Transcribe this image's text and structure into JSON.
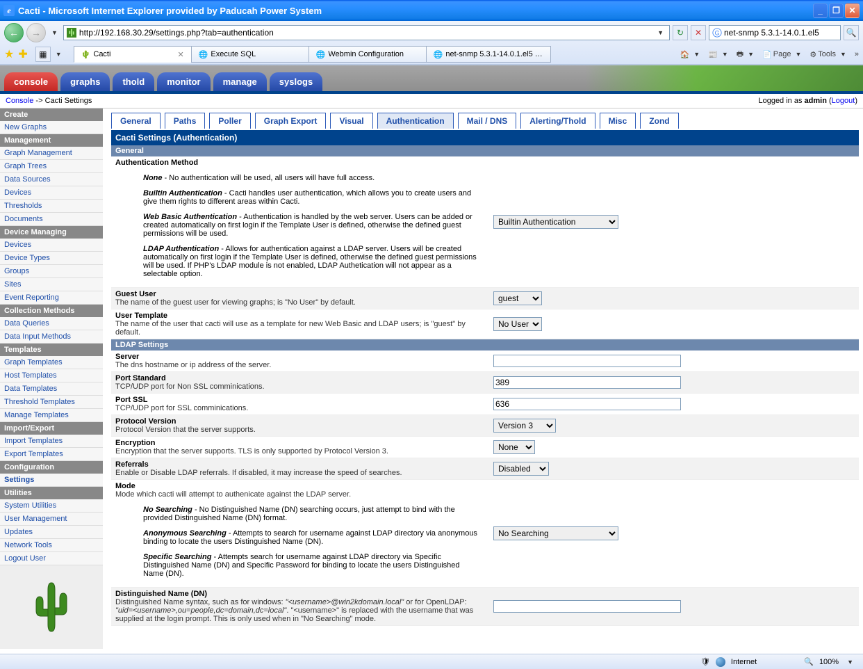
{
  "window": {
    "title": "Cacti - Microsoft Internet Explorer provided by Paducah Power System"
  },
  "address_bar": {
    "url": "http://192.168.30.29/settings.php?tab=authentication"
  },
  "search_box": {
    "value": "net-snmp 5.3.1-14.0.1.el5"
  },
  "browser_tabs": [
    {
      "label": "Cacti",
      "active": true
    },
    {
      "label": "Execute SQL",
      "active": false
    },
    {
      "label": "Webmin Configuration",
      "active": false
    },
    {
      "label": "net-snmp 5.3.1-14.0.1.el5 - …",
      "active": false
    }
  ],
  "ie_tools": {
    "page": "Page",
    "tools": "Tools"
  },
  "cacti_nav_tabs": [
    {
      "label": "console",
      "style": "red"
    },
    {
      "label": "graphs",
      "style": "blue"
    },
    {
      "label": "thold",
      "style": "blue"
    },
    {
      "label": "monitor",
      "style": "blue"
    },
    {
      "label": "manage",
      "style": "blue"
    },
    {
      "label": "syslogs",
      "style": "blue"
    }
  ],
  "breadcrumb": {
    "root": "Console",
    "sep": " -> ",
    "current": "Cacti Settings",
    "logged_in_prefix": "Logged in as ",
    "user": "admin",
    "logout_open": " (",
    "logout": "Logout",
    "logout_close": ")"
  },
  "sidebar": [
    {
      "type": "header",
      "text": "Create"
    },
    {
      "type": "link",
      "text": "New Graphs"
    },
    {
      "type": "header",
      "text": "Management"
    },
    {
      "type": "link",
      "text": "Graph Management"
    },
    {
      "type": "link",
      "text": "Graph Trees"
    },
    {
      "type": "link",
      "text": "Data Sources"
    },
    {
      "type": "link",
      "text": "Devices"
    },
    {
      "type": "link",
      "text": "Thresholds"
    },
    {
      "type": "link",
      "text": "Documents"
    },
    {
      "type": "header",
      "text": "Device Managing"
    },
    {
      "type": "link",
      "text": "Devices"
    },
    {
      "type": "link",
      "text": "Device Types"
    },
    {
      "type": "link",
      "text": "Groups"
    },
    {
      "type": "link",
      "text": "Sites"
    },
    {
      "type": "link",
      "text": "Event Reporting"
    },
    {
      "type": "header",
      "text": "Collection Methods"
    },
    {
      "type": "link",
      "text": "Data Queries"
    },
    {
      "type": "link",
      "text": "Data Input Methods"
    },
    {
      "type": "header",
      "text": "Templates"
    },
    {
      "type": "link",
      "text": "Graph Templates"
    },
    {
      "type": "link",
      "text": "Host Templates"
    },
    {
      "type": "link",
      "text": "Data Templates"
    },
    {
      "type": "link",
      "text": "Threshold Templates"
    },
    {
      "type": "link",
      "text": "Manage Templates"
    },
    {
      "type": "header",
      "text": "Import/Export"
    },
    {
      "type": "link",
      "text": "Import Templates"
    },
    {
      "type": "link",
      "text": "Export Templates"
    },
    {
      "type": "header",
      "text": "Configuration"
    },
    {
      "type": "link",
      "text": "Settings",
      "bold": true
    },
    {
      "type": "header",
      "text": "Utilities"
    },
    {
      "type": "link",
      "text": "System Utilities"
    },
    {
      "type": "link",
      "text": "User Management"
    },
    {
      "type": "link",
      "text": "Updates"
    },
    {
      "type": "link",
      "text": "Network Tools"
    },
    {
      "type": "link",
      "text": "Logout User"
    }
  ],
  "settings_tabs": [
    {
      "label": "General"
    },
    {
      "label": "Paths"
    },
    {
      "label": "Poller"
    },
    {
      "label": "Graph Export"
    },
    {
      "label": "Visual"
    },
    {
      "label": "Authentication",
      "active": true
    },
    {
      "label": "Mail / DNS"
    },
    {
      "label": "Alerting/Thold"
    },
    {
      "label": "Misc"
    },
    {
      "label": "Zond"
    }
  ],
  "settings_title": "Cacti Settings (Authentication)",
  "sections": {
    "general": "General",
    "ldap": "LDAP Settings"
  },
  "auth_method": {
    "label": "Authentication Method",
    "none_t": "None",
    "none_d": " - No authentication will be used, all users will have full access.",
    "builtin_t": "Builtin Authentication",
    "builtin_d": " - Cacti handles user authentication, which allows you to create users and give them rights to different areas within Cacti.",
    "web_t": "Web Basic Authentication",
    "web_d": " - Authentication is handled by the web server. Users can be added or created automatically on first login if the Template User is defined, otherwise the defined guest permissions will be used.",
    "ldap_t": "LDAP Authentication",
    "ldap_d": " - Allows for authentication against a LDAP server. Users will be created automatically on first login if the Template User is defined, otherwise the defined guest permissions will be used. If PHP's LDAP module is not enabled, LDAP Authetication will not appear as a selectable option.",
    "value": "Builtin Authentication"
  },
  "guest_user": {
    "label": "Guest User",
    "help": "The name of the guest user for viewing graphs; is \"No User\" by default.",
    "value": "guest"
  },
  "user_template": {
    "label": "User Template",
    "help": "The name of the user that cacti will use as a template for new Web Basic and LDAP users; is \"guest\" by default.",
    "value": "No User"
  },
  "server": {
    "label": "Server",
    "help": "The dns hostname or ip address of the server.",
    "value": ""
  },
  "port_std": {
    "label": "Port Standard",
    "help": "TCP/UDP port for Non SSL comminications.",
    "value": "389"
  },
  "port_ssl": {
    "label": "Port SSL",
    "help": "TCP/UDP port for SSL comminications.",
    "value": "636"
  },
  "proto_ver": {
    "label": "Protocol Version",
    "help": "Protocol Version that the server supports.",
    "value": "Version 3"
  },
  "encryption": {
    "label": "Encryption",
    "help": "Encryption that the server supports. TLS is only supported by Protocol Version 3.",
    "value": "None"
  },
  "referrals": {
    "label": "Referrals",
    "help": "Enable or Disable LDAP referrals. If disabled, it may increase the speed of searches.",
    "value": "Disabled"
  },
  "mode": {
    "label": "Mode",
    "help": "Mode which cacti will attempt to authenicate against the LDAP server.",
    "ns_t": "No Searching",
    "ns_d": " - No Distinguished Name (DN) searching occurs, just attempt to bind with the provided Distinguished Name (DN) format.",
    "as_t": "Anonymous Searching",
    "as_d": " - Attempts to search for username against LDAP directory via anonymous binding to locate the users Distinguished Name (DN).",
    "ss_t": "Specific Searching",
    "ss_d": " - Attempts search for username against LDAP directory via Specific Distinguished Name (DN) and Specific Password for binding to locate the users Distinguished Name (DN).",
    "value": "No Searching"
  },
  "dn": {
    "label": "Distinguished Name (DN)",
    "help_1": "Distinguished Name syntax, such as for windows: ",
    "help_ex1": "\"<username>@win2kdomain.local\"",
    "help_2": " or for OpenLDAP: ",
    "help_ex2": "\"uid=<username>,ou=people,dc=domain,dc=local\"",
    "help_3": ". \"<username>\" is replaced with the username that was supplied at the login prompt. This is only used when in \"No Searching\" mode.",
    "value": ""
  },
  "status": {
    "zone": "Internet",
    "zoom": "100%"
  }
}
